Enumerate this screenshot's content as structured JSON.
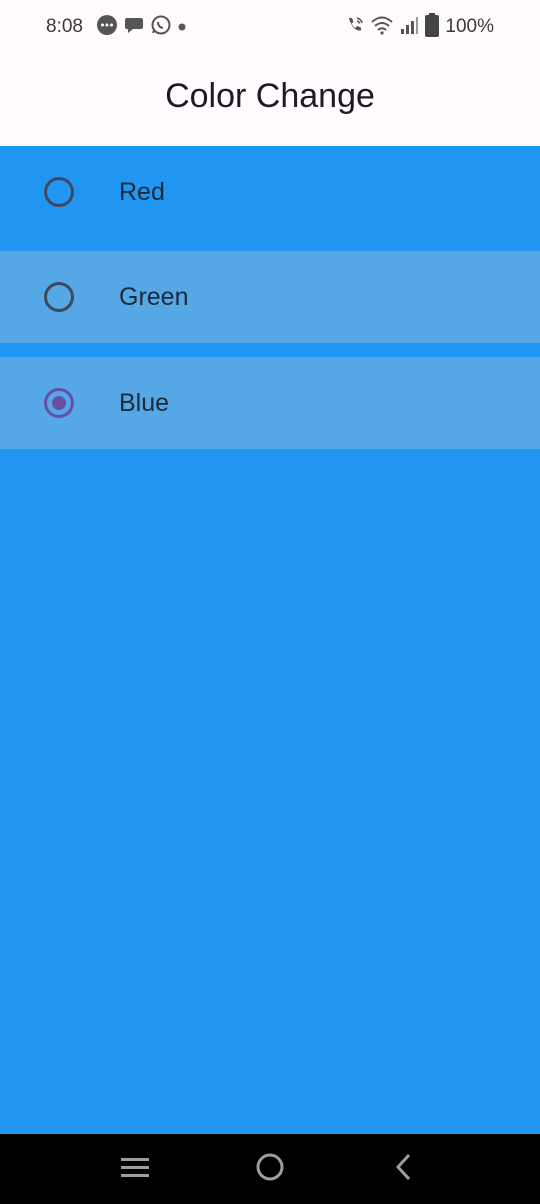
{
  "status_bar": {
    "time": "8:08",
    "left_icons": [
      "messages-icon",
      "chat-icon",
      "whatsapp-icon",
      "dot-icon"
    ],
    "right_icons": [
      "wifi-calling-icon",
      "wifi-icon",
      "signal-icon",
      "battery-icon"
    ],
    "battery": "100%"
  },
  "app_bar": {
    "title": "Color Change"
  },
  "options": [
    {
      "label": "Red",
      "selected": false
    },
    {
      "label": "Green",
      "selected": false
    },
    {
      "label": "Blue",
      "selected": true
    }
  ],
  "colors": {
    "background": "#2196F3",
    "app_bar": "#FFFBFE",
    "row_highlight": "#56A7E6",
    "radio_selected": "#6750A4",
    "radio_unselected": "#3E4A5C",
    "nav_bar": "#000000"
  },
  "nav_bar": {
    "buttons": [
      "recent-apps-icon",
      "home-icon",
      "back-icon"
    ]
  }
}
